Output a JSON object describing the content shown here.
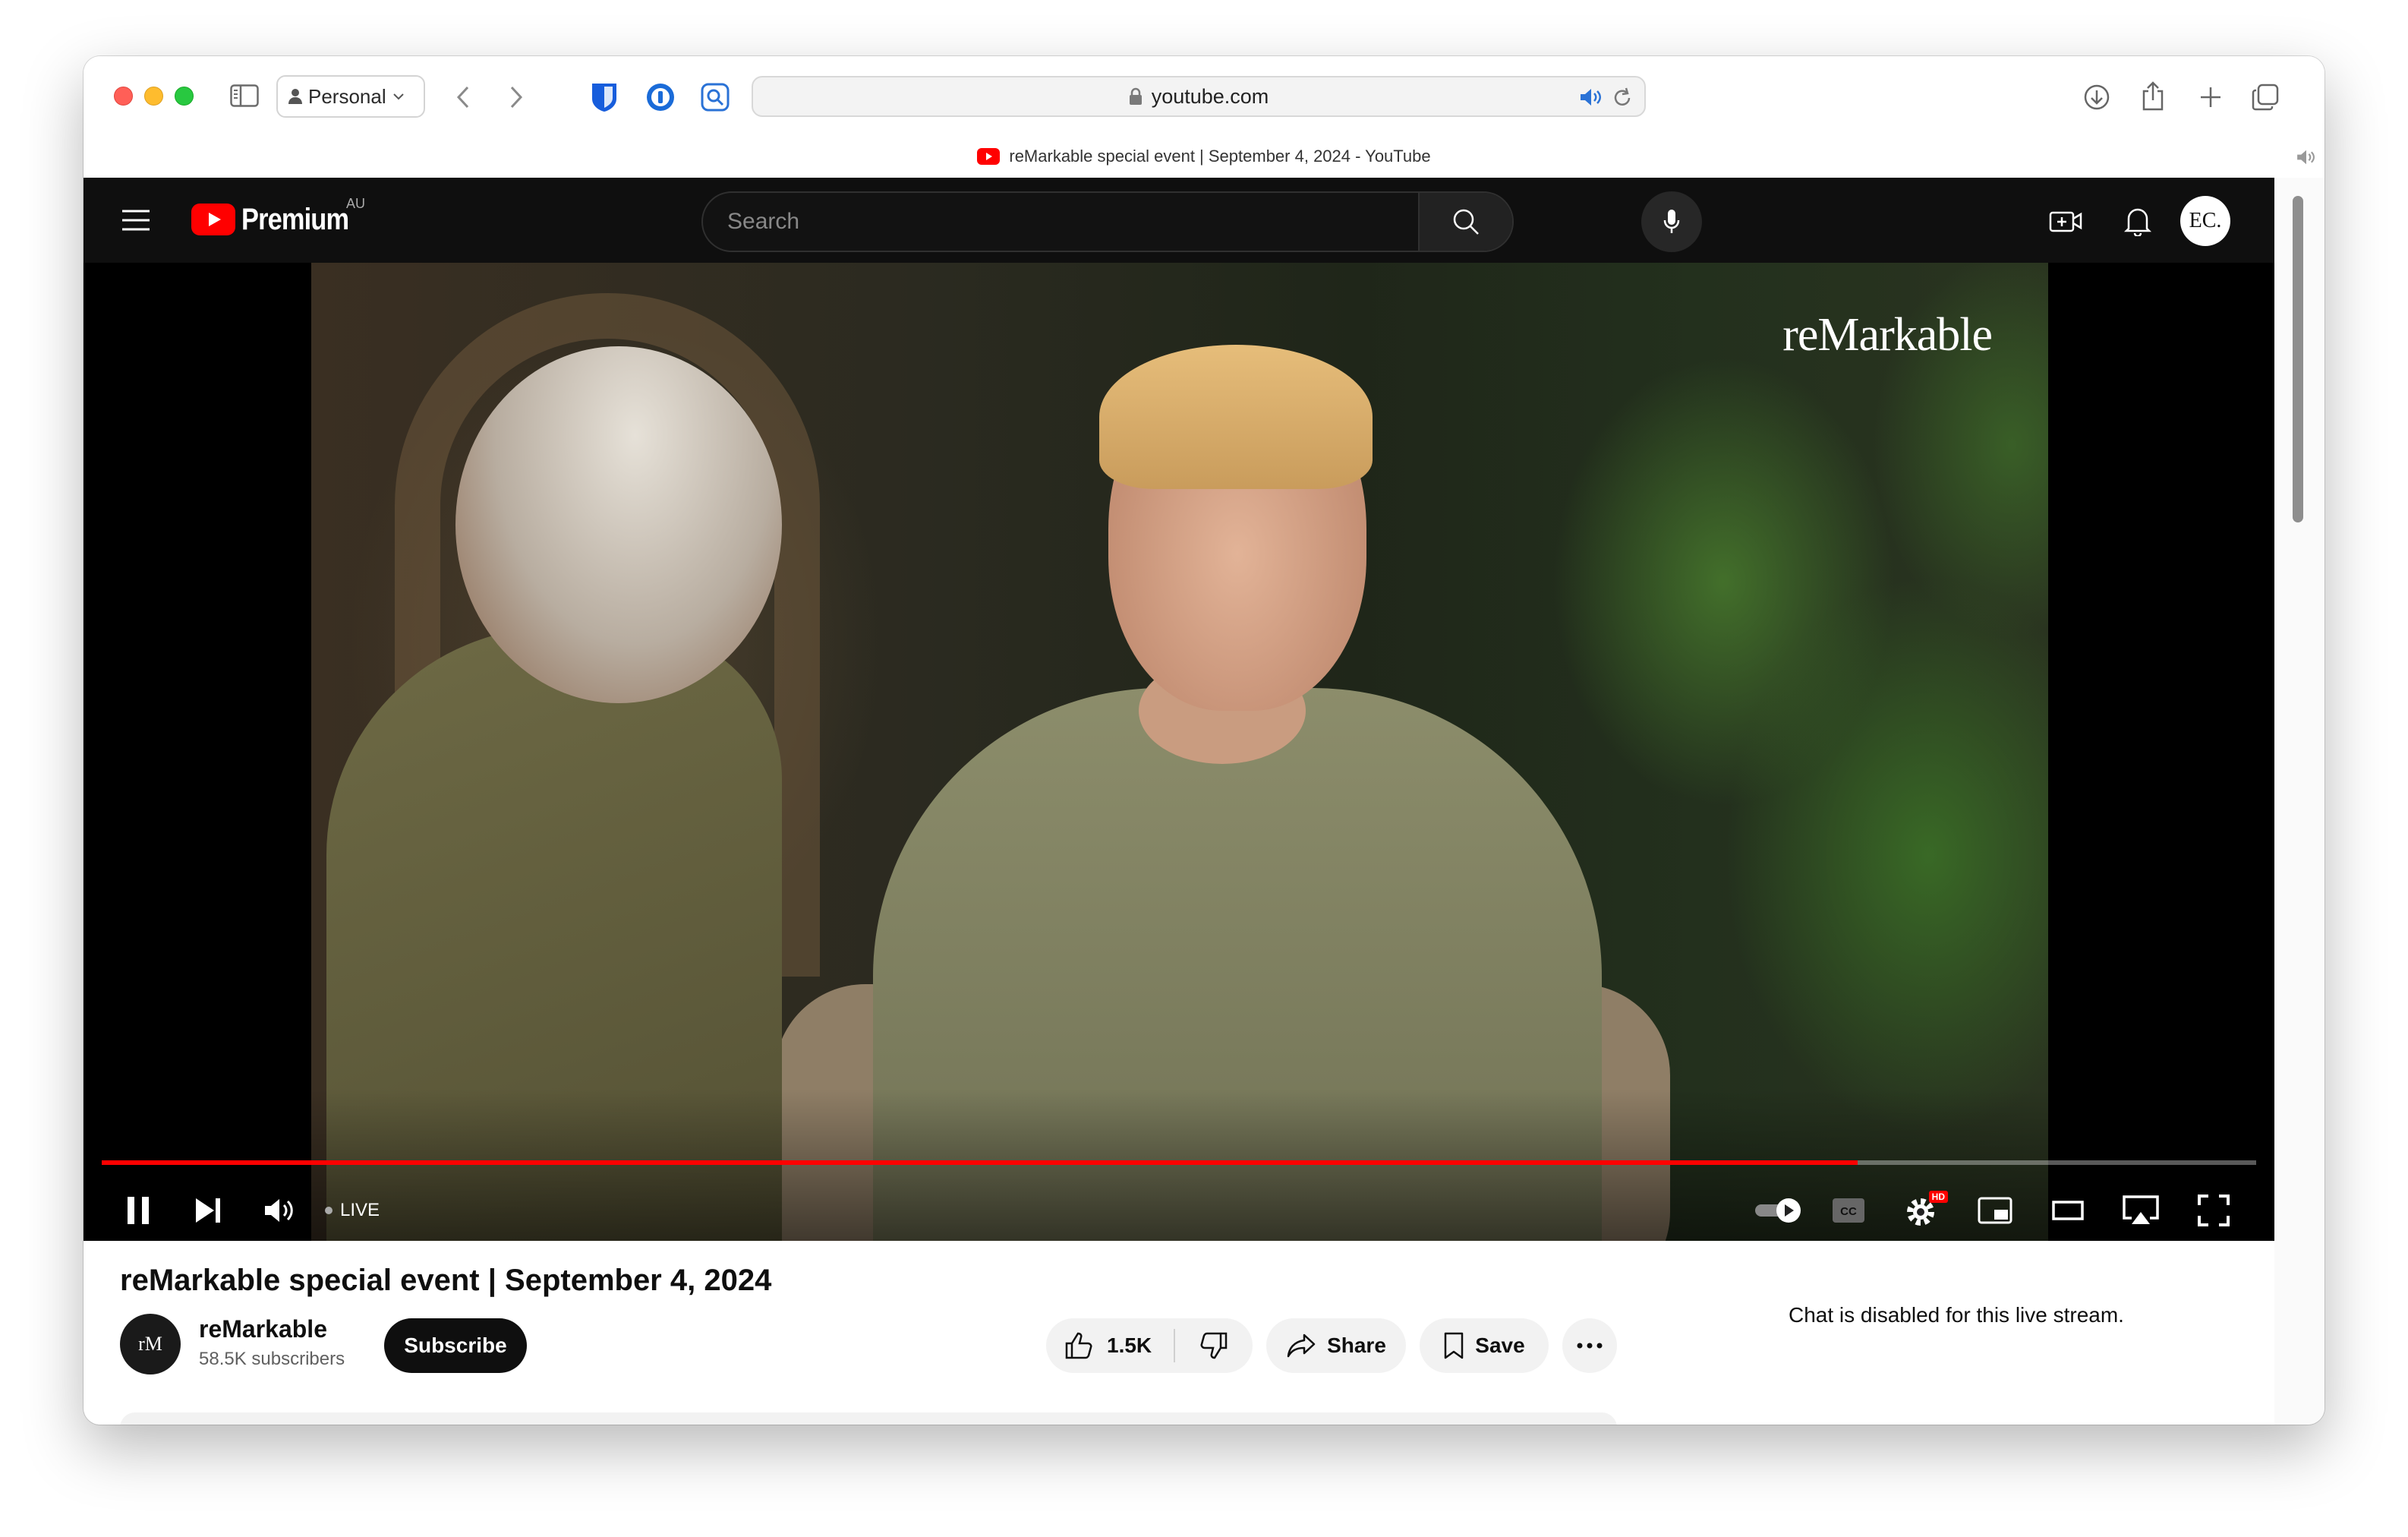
{
  "browser": {
    "profile_label": "Personal",
    "url": "youtube.com",
    "tab_title": "reMarkable special event | September 4, 2024 - YouTube"
  },
  "youtube": {
    "logo_text": "Premium",
    "region": "AU",
    "search_placeholder": "Search",
    "avatar_initials": "EC."
  },
  "player": {
    "watermark": "reMarkable",
    "live_label": "LIVE",
    "progress": 0.815,
    "hd_badge": "HD"
  },
  "video": {
    "title": "reMarkable special event | September 4, 2024",
    "channel_avatar": "rM",
    "channel_name": "reMarkable",
    "subscribers": "58.5K subscribers",
    "subscribe_label": "Subscribe",
    "like_count": "1.5K",
    "share_label": "Share",
    "save_label": "Save"
  },
  "chat": {
    "message": "Chat is disabled for this live stream."
  },
  "colors": {
    "yt_red": "#ff0000",
    "header_bg": "#0f0f0f"
  }
}
